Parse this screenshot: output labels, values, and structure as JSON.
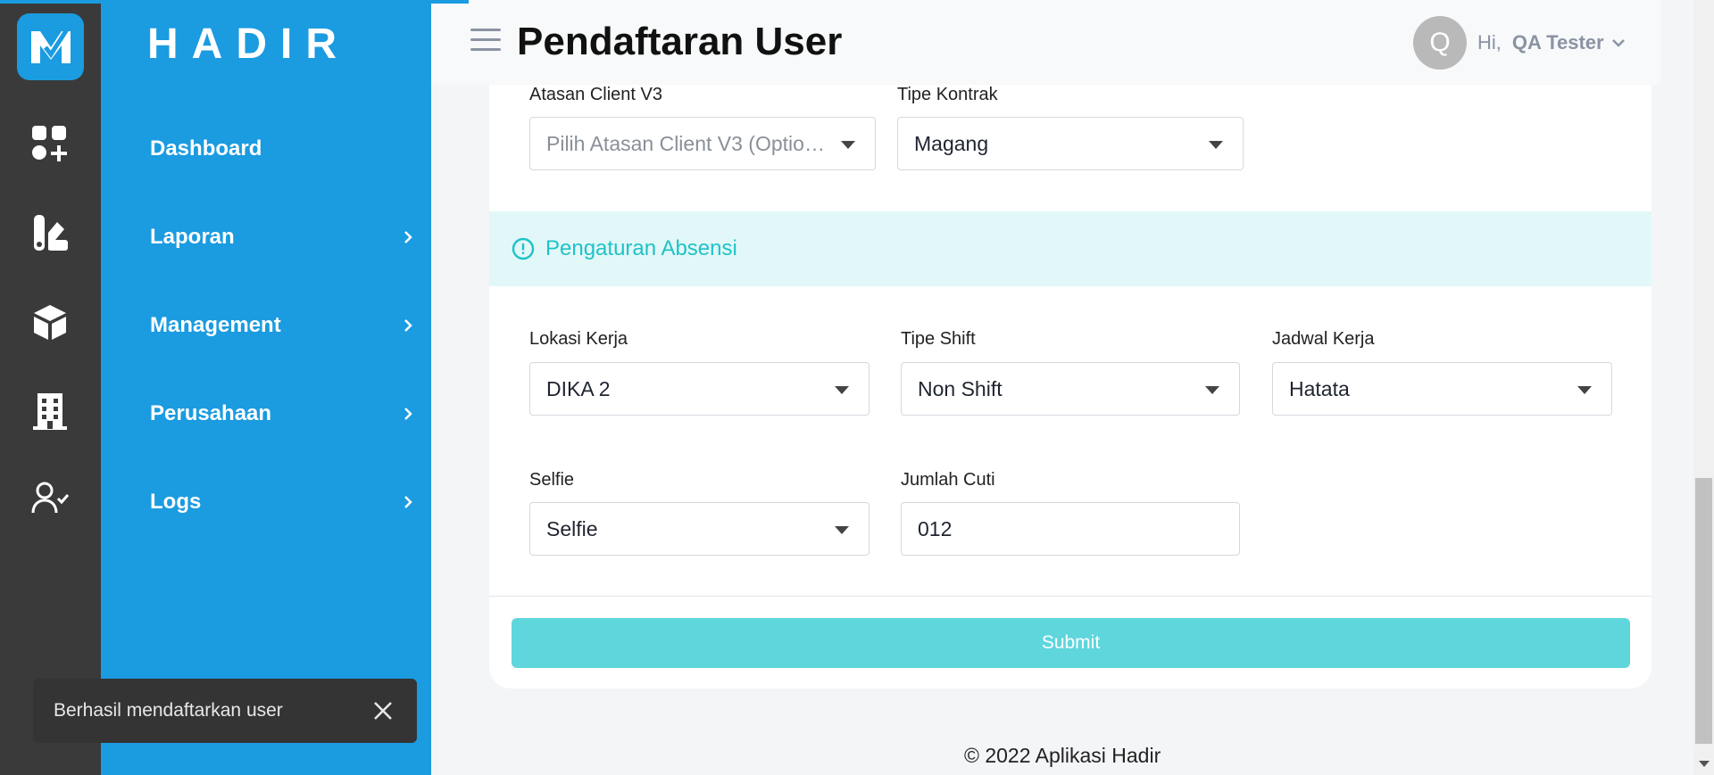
{
  "app": {
    "brand": "HADIR"
  },
  "header": {
    "title": "Pendaftaran User",
    "greeting": "Hi,",
    "user_name": "QA Tester",
    "avatar_initial": "Q"
  },
  "sidebar": {
    "items": [
      {
        "label": "Dashboard",
        "has_children": false
      },
      {
        "label": "Laporan",
        "has_children": true
      },
      {
        "label": "Management",
        "has_children": true
      },
      {
        "label": "Perusahaan",
        "has_children": true
      },
      {
        "label": "Logs",
        "has_children": true
      }
    ]
  },
  "form": {
    "atasan_client": {
      "label": "Atasan Client V3",
      "placeholder": "Pilih Atasan Client V3 (Optional)"
    },
    "tipe_kontrak": {
      "label": "Tipe Kontrak",
      "value": "Magang"
    },
    "section_absensi": {
      "title": "Pengaturan Absensi"
    },
    "lokasi_kerja": {
      "label": "Lokasi Kerja",
      "value": "DIKA 2"
    },
    "tipe_shift": {
      "label": "Tipe Shift",
      "value": "Non Shift"
    },
    "jadwal_kerja": {
      "label": "Jadwal Kerja",
      "value": "Hatata"
    },
    "selfie": {
      "label": "Selfie",
      "value": "Selfie"
    },
    "jumlah_cuti": {
      "label": "Jumlah Cuti",
      "value": "012"
    },
    "submit_label": "Submit"
  },
  "footer": {
    "text": "© 2022 Aplikasi Hadir"
  },
  "toast": {
    "message": "Berhasil mendaftarkan user"
  },
  "colors": {
    "primary": "#1b9be0",
    "rail": "#3a3a3a",
    "accent_teal": "#1fc2c8",
    "submit": "#5ed6dc"
  }
}
